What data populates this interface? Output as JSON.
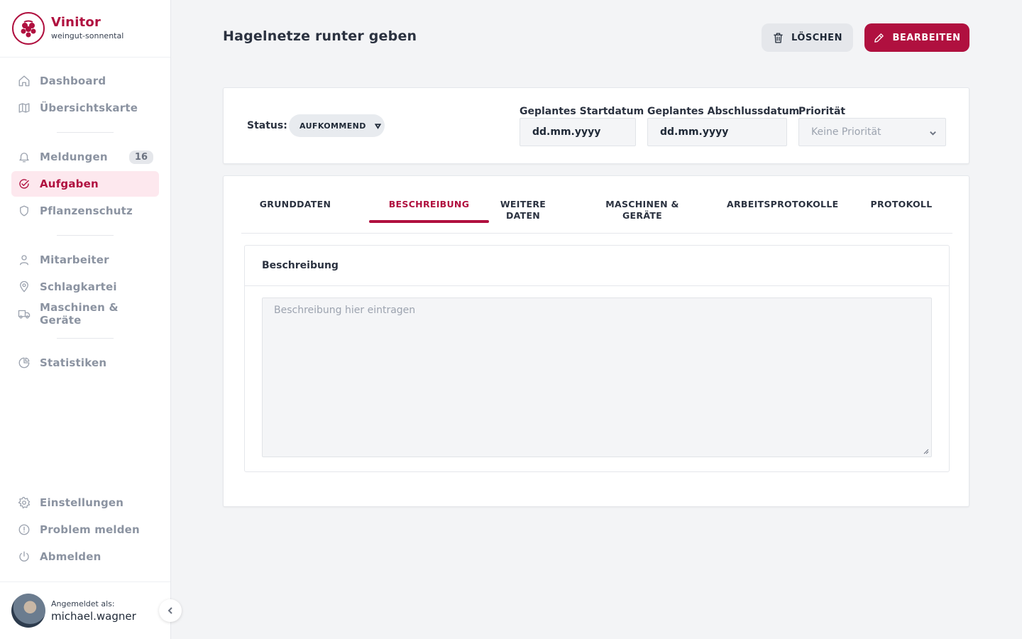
{
  "brand": {
    "name": "Vinitor",
    "subtitle": "weingut-sonnental"
  },
  "sidebar": {
    "items": [
      {
        "label": "Dashboard",
        "icon": "home-icon"
      },
      {
        "label": "Übersichtskarte",
        "icon": "map-icon"
      },
      {
        "label": "Meldungen",
        "icon": "bell-icon",
        "badge": "16"
      },
      {
        "label": "Aufgaben",
        "icon": "check-circle-icon",
        "active": true
      },
      {
        "label": "Pflanzenschutz",
        "icon": "shield-icon"
      },
      {
        "label": "Mitarbeiter",
        "icon": "user-icon"
      },
      {
        "label": "Schlagkartei",
        "icon": "map-pin-icon"
      },
      {
        "label": "Maschinen & Geräte",
        "icon": "truck-icon"
      },
      {
        "label": "Statistiken",
        "icon": "pie-chart-icon"
      }
    ],
    "bottom_items": [
      {
        "label": "Einstellungen",
        "icon": "gear-icon"
      },
      {
        "label": "Problem melden",
        "icon": "alert-circle-icon"
      },
      {
        "label": "Abmelden",
        "icon": "power-icon"
      }
    ],
    "user": {
      "label": "Angemeldet als:",
      "name": "michael.wagner"
    }
  },
  "header": {
    "title": "Hagelnetze runter geben",
    "delete_label": "LÖSCHEN",
    "edit_label": "BEARBEITEN"
  },
  "status_card": {
    "status_label": "Status:",
    "status_value": "AUFKOMMEND",
    "start_label": "Geplantes Startdatum",
    "start_value": "dd.mm.yyyy",
    "end_label": "Geplantes Abschlussdatum",
    "end_value": "dd.mm.yyyy",
    "priority_label": "Priorität",
    "priority_value": "Keine Priorität"
  },
  "tabs": {
    "items": [
      {
        "label": "GRUNDDATEN"
      },
      {
        "label": "BESCHREIBUNG",
        "active": true
      },
      {
        "label": "WEITERE DATEN"
      },
      {
        "label": "MASCHINEN & GERÄTE"
      },
      {
        "label": "ARBEITSPROTOKOLLE"
      },
      {
        "label": "PROTOKOLL"
      }
    ]
  },
  "description": {
    "heading": "Beschreibung",
    "placeholder": "Beschreibung hier eintragen",
    "value": ""
  },
  "colors": {
    "accent": "#b0103f",
    "active_bg": "#fde8ee",
    "background": "#f3f4f6"
  }
}
